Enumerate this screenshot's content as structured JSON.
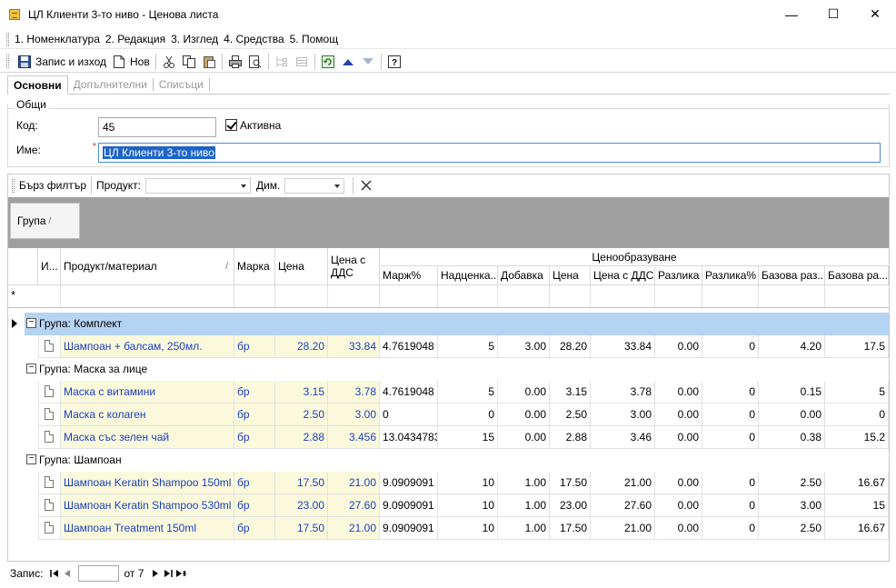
{
  "window": {
    "title": "ЦЛ Клиенти 3-то ниво - Ценова листа",
    "minimize": "—",
    "maximize": "☐",
    "close": "✕"
  },
  "menu": {
    "items": [
      "1. Номенклатура",
      "2. Редакция",
      "3. Изглед",
      "4. Средства",
      "5. Помощ"
    ]
  },
  "toolbar": {
    "save_label": "Запис и изход",
    "new_label": "Нов"
  },
  "tabs": [
    "Основни",
    "Допълнителни",
    "Списъци"
  ],
  "general": {
    "caption": "Общи",
    "code_label": "Код:",
    "code_value": "45",
    "active_label": "Активна",
    "name_label": "Име:",
    "name_value": "ЦЛ Клиенти 3-то ниво"
  },
  "filter": {
    "quick_label": "Бърз филтър",
    "product_label": "Продукт:",
    "dim_label": "Дим."
  },
  "grouping": {
    "chip_label": "Група",
    "chip_sort": "/"
  },
  "columns": {
    "info": "И...",
    "product": "Продукт/материал",
    "product_sort": "/",
    "brand": "Марка",
    "price": "Цена",
    "price_vat": "Цена с ДДС",
    "band": "Ценообразуване",
    "margin": "Марж%",
    "markup": "Надценка...",
    "addition": "Добавка",
    "band_price": "Цена",
    "band_price_vat": "Цена с ДДС",
    "diff": "Разлика",
    "diff_pct": "Разлика%",
    "base_diff": "Базова раз...",
    "base": "Базова ра..."
  },
  "new_row_marker": "*",
  "groups": [
    {
      "label": "Група: Комплект",
      "rows": [
        {
          "product": "Шампоан + балсам, 250мл.",
          "brand": "бр",
          "price": "28.20",
          "price_vat": "33.84",
          "margin": "4.7619048",
          "markup": "5",
          "addition": "3.00",
          "band_price": "28.20",
          "band_price_vat": "33.84",
          "diff": "0.00",
          "diff_pct": "0",
          "base_diff": "4.20",
          "base": "17.5"
        }
      ]
    },
    {
      "label": "Група: Маска за лице",
      "rows": [
        {
          "product": "Маска с витамини",
          "brand": "бр",
          "price": "3.15",
          "price_vat": "3.78",
          "margin": "4.7619048",
          "markup": "5",
          "addition": "0.00",
          "band_price": "3.15",
          "band_price_vat": "3.78",
          "diff": "0.00",
          "diff_pct": "0",
          "base_diff": "0.15",
          "base": "5"
        },
        {
          "product": "Маска с колаген",
          "brand": "бр",
          "price": "2.50",
          "price_vat": "3.00",
          "margin": "0",
          "markup": "0",
          "addition": "0.00",
          "band_price": "2.50",
          "band_price_vat": "3.00",
          "diff": "0.00",
          "diff_pct": "0",
          "base_diff": "0.00",
          "base": "0"
        },
        {
          "product": "Маска със зелен чай",
          "brand": "бр",
          "price": "2.88",
          "price_vat": "3.456",
          "margin": "13.0434783",
          "markup": "15",
          "addition": "0.00",
          "band_price": "2.88",
          "band_price_vat": "3.46",
          "diff": "0.00",
          "diff_pct": "0",
          "base_diff": "0.38",
          "base": "15.2"
        }
      ]
    },
    {
      "label": "Група: Шампоан",
      "rows": [
        {
          "product": "Шампоан Keratin Shampoo 150ml",
          "brand": "бр",
          "price": "17.50",
          "price_vat": "21.00",
          "margin": "9.0909091",
          "markup": "10",
          "addition": "1.00",
          "band_price": "17.50",
          "band_price_vat": "21.00",
          "diff": "0.00",
          "diff_pct": "0",
          "base_diff": "2.50",
          "base": "16.67"
        },
        {
          "product": "Шампоан Keratin Shampoo 530ml",
          "brand": "бр",
          "price": "23.00",
          "price_vat": "27.60",
          "margin": "9.0909091",
          "markup": "10",
          "addition": "1.00",
          "band_price": "23.00",
          "band_price_vat": "27.60",
          "diff": "0.00",
          "diff_pct": "0",
          "base_diff": "3.00",
          "base": "15"
        },
        {
          "product": "Шампоан Treatment 150ml",
          "brand": "бр",
          "price": "17.50",
          "price_vat": "21.00",
          "margin": "9.0909091",
          "markup": "10",
          "addition": "1.00",
          "band_price": "17.50",
          "band_price_vat": "21.00",
          "diff": "0.00",
          "diff_pct": "0",
          "base_diff": "2.50",
          "base": "16.67"
        }
      ]
    }
  ],
  "navigator": {
    "label": "Запис:",
    "of_label": "от 7"
  }
}
